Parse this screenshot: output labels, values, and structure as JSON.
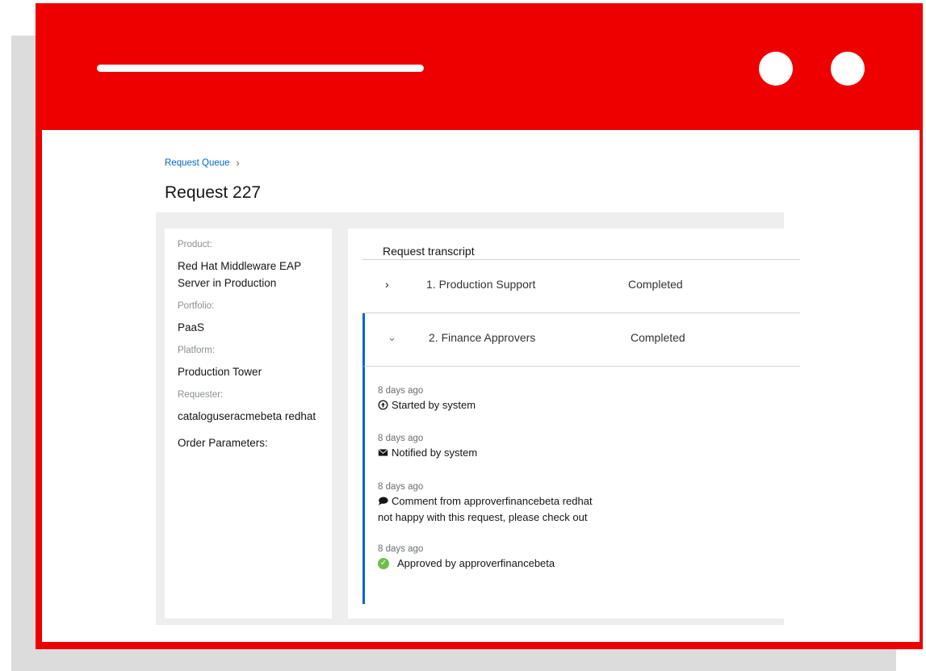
{
  "breadcrumb": {
    "parent": "Request Queue",
    "separator": "›"
  },
  "page": {
    "title": "Request 227"
  },
  "details": {
    "product_label": "Product:",
    "product_value": "Red Hat Middleware EAP Server in Production",
    "portfolio_label": "Portfolio:",
    "portfolio_value": "PaaS",
    "platform_label": "Platform:",
    "platform_value": "Production Tower",
    "requester_label": "Requester:",
    "requester_value": "cataloguseracmebeta redhat",
    "order_params_label": "Order Parameters:"
  },
  "transcript": {
    "heading": "Request transcript",
    "stages": [
      {
        "name": "1. Production Support",
        "status": "Completed",
        "expanded": false
      },
      {
        "name": "2. Finance Approvers",
        "status": "Completed",
        "expanded": true
      }
    ],
    "events": [
      {
        "time": "8 days ago",
        "text": "Started by system",
        "icon": "play-circle-icon"
      },
      {
        "time": "8 days ago",
        "text": "Notified by system",
        "icon": "envelope-icon"
      },
      {
        "time": "8 days ago",
        "text": "Comment from approverfinancebeta redhat",
        "comment": "not happy with this request, please check out",
        "icon": "comment-icon"
      },
      {
        "time": "8 days ago",
        "text": "Approved by approverfinancebeta",
        "icon": "check-circle-icon"
      }
    ]
  },
  "colors": {
    "frame": "#ee0000",
    "link": "#0066cc",
    "success": "#6cc04a"
  }
}
